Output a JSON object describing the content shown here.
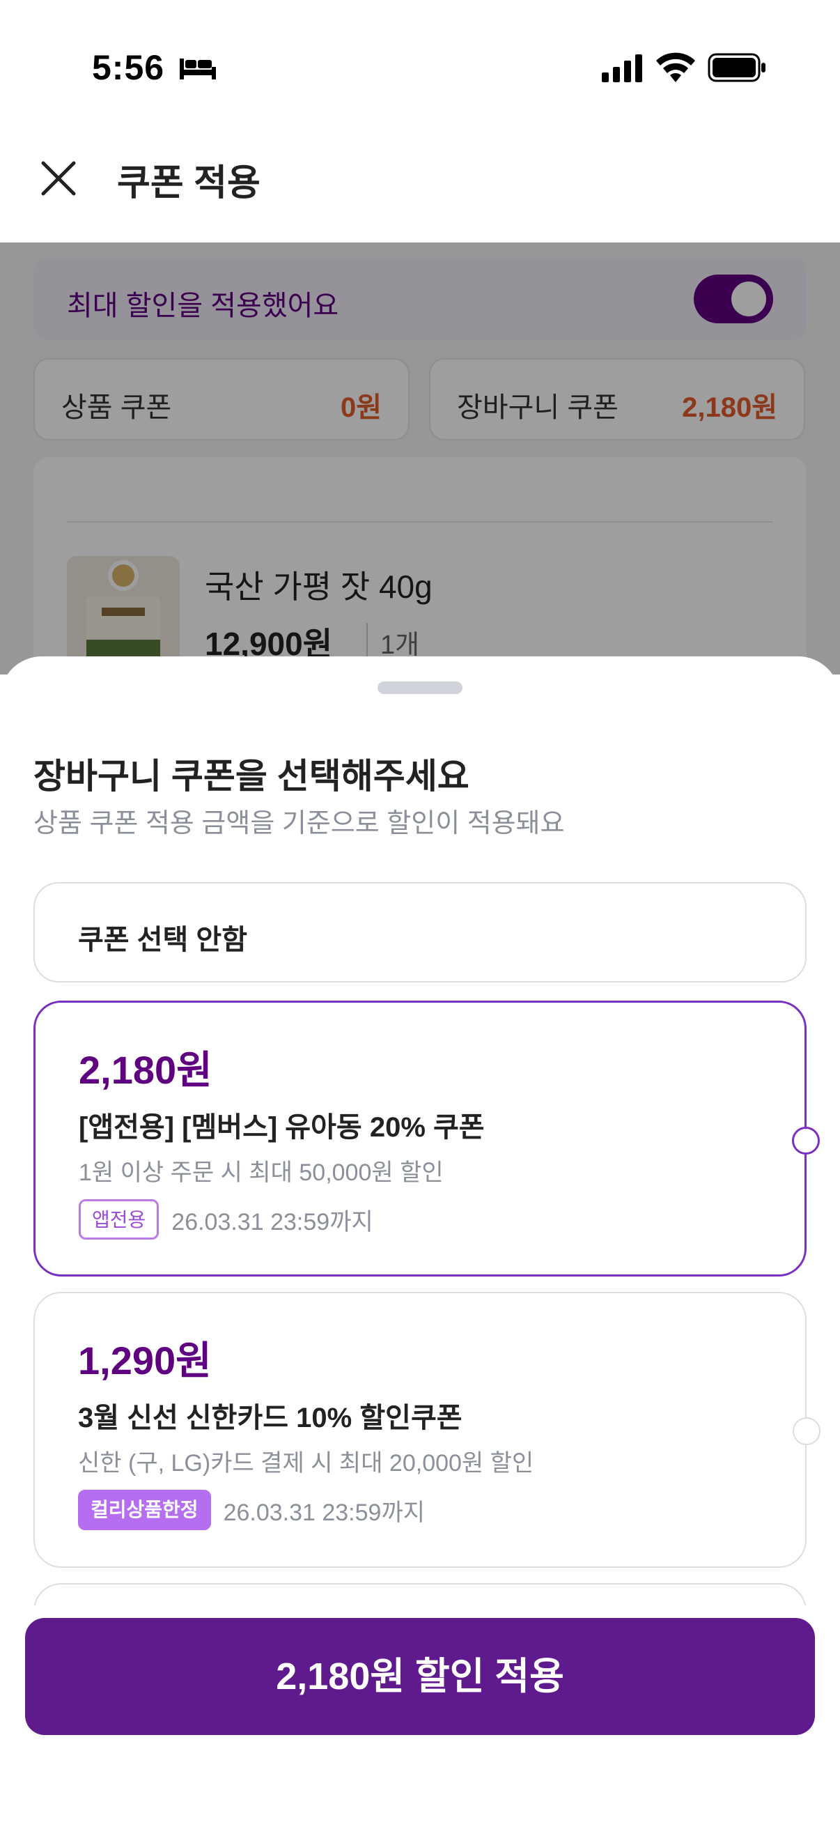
{
  "status_bar": {
    "time": "5:56"
  },
  "header": {
    "title": "쿠폰 적용"
  },
  "background": {
    "max_discount_text": "최대 할인을 적용했어요",
    "product_coupon_label": "상품 쿠폰",
    "product_coupon_value": "0원",
    "cart_coupon_label": "장바구니 쿠폰",
    "cart_coupon_value": "2,180원",
    "product_name": "국산 가평 잣 40g",
    "product_price": "12,900원",
    "product_qty": "1개"
  },
  "sheet": {
    "title": "장바구니 쿠폰을 선택해주세요",
    "subtitle": "상품 쿠폰 적용 금액을 기준으로 할인이 적용돼요",
    "no_coupon_label": "쿠폰 선택 안함",
    "coupons": [
      {
        "amount": "2,180원",
        "name": "[앱전용] [멤버스] 유아동 20% 쿠폰",
        "condition": "1원 이상 주문 시 최대 50,000원 할인",
        "badge": "앱전용",
        "expiry": "26.03.31 23:59까지",
        "selected": true
      },
      {
        "amount": "1,290원",
        "name": "3월 신선 신한카드 10% 할인쿠폰",
        "condition": "신한 (구, LG)카드 결제 시 최대 20,000원 할인",
        "badge": "컬리상품한정",
        "expiry": "26.03.31 23:59까지",
        "selected": false
      }
    ],
    "apply_button": "2,180원 할인 적용"
  },
  "colors": {
    "brand": "#5f0080",
    "apply_button": "#5f1a8e",
    "discount_orange": "#e05b2c"
  }
}
